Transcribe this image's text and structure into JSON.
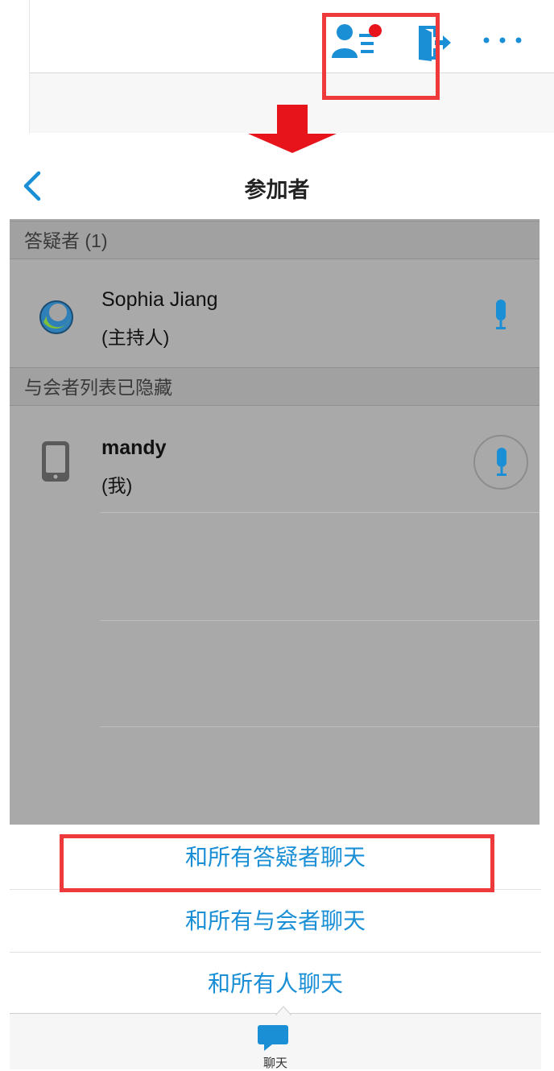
{
  "nav": {
    "title": "参加者"
  },
  "sections": {
    "panelists_header": "答疑者 (1)",
    "attendees_header": "与会者列表已隐藏"
  },
  "participants": [
    {
      "name": "Sophia Jiang",
      "role": "(主持人)"
    },
    {
      "name": "mandy",
      "role": "(我)"
    }
  ],
  "chat_options": [
    "和所有答疑者聊天",
    "和所有与会者聊天",
    "和所有人聊天"
  ],
  "bottom_tab": {
    "label": "聊天"
  },
  "colors": {
    "accent": "#1a8fd6",
    "highlight": "#ee3a3a",
    "notification": "#e8141b",
    "dim_overlay": "#a9a9a9"
  },
  "icons": {
    "participants": "participants-list-icon",
    "leave": "leave-meeting-icon",
    "more": "more-options-icon",
    "back": "back-chevron-icon",
    "mic": "microphone-icon",
    "chat": "chat-bubble-icon"
  }
}
